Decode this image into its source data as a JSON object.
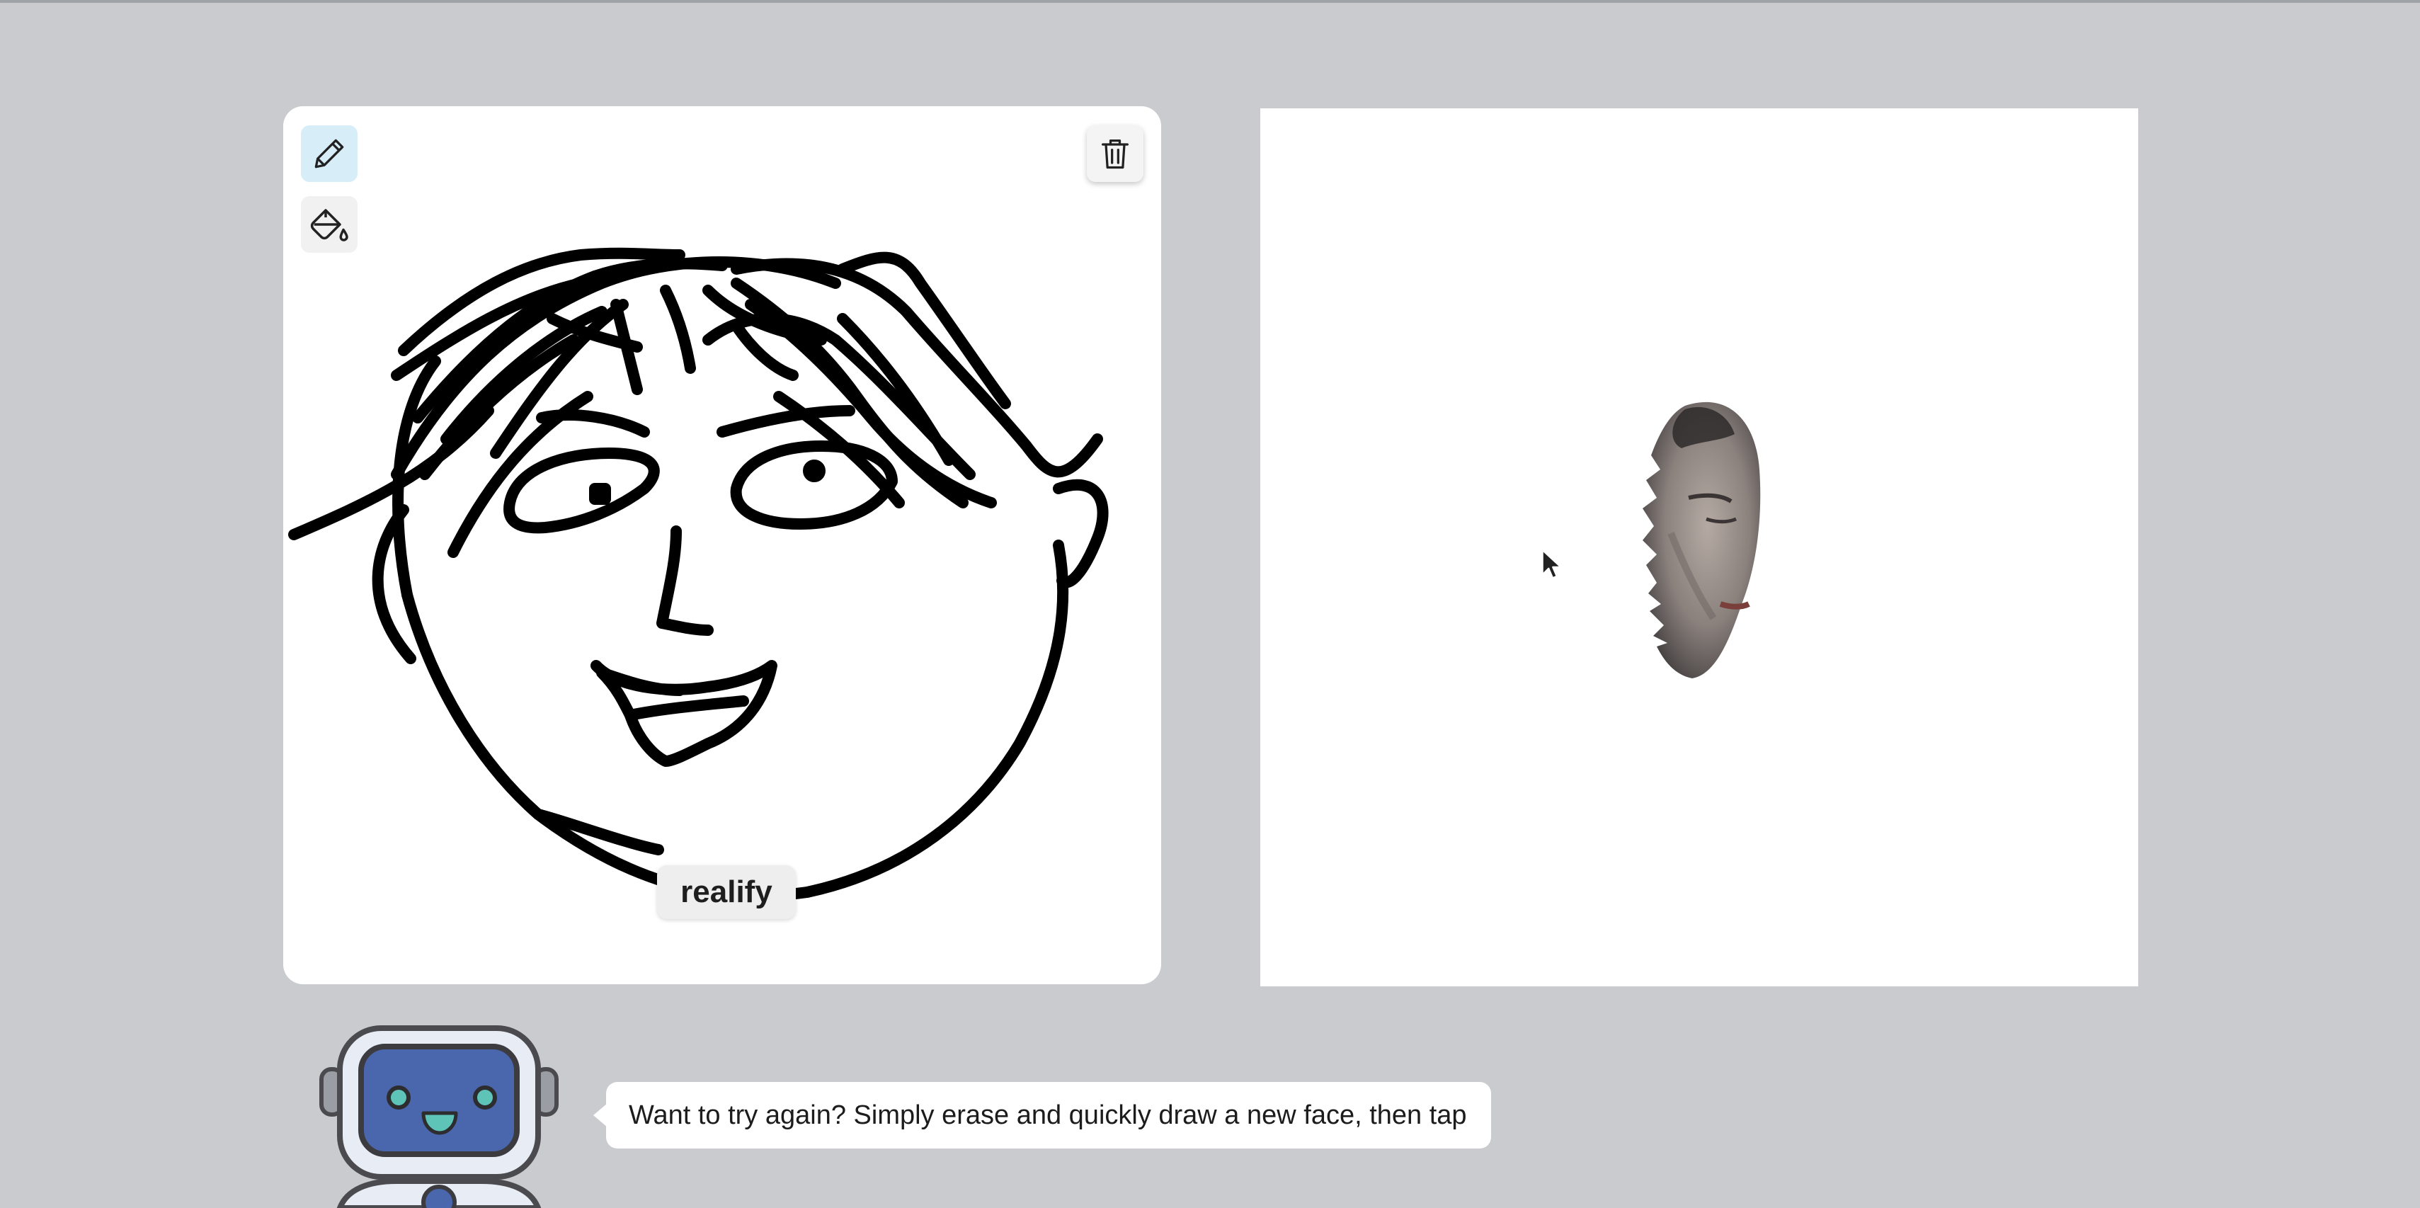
{
  "draw_panel": {
    "tools": {
      "pencil_icon": "pencil-icon",
      "fill_icon": "paint-bucket-icon",
      "clear_icon": "trash-icon"
    },
    "realify_label": "realify"
  },
  "result_panel": {
    "image": "generated-face-image"
  },
  "assistant": {
    "avatar": "robot-avatar",
    "message": "Want to try again? Simply erase and quickly draw a new face, then tap"
  },
  "colors": {
    "background": "#c9cbcf",
    "panel": "#ffffff",
    "active_tool": "#d7edf7",
    "robot_screen": "#4a67ad",
    "robot_eyes": "#5ec4b8"
  }
}
